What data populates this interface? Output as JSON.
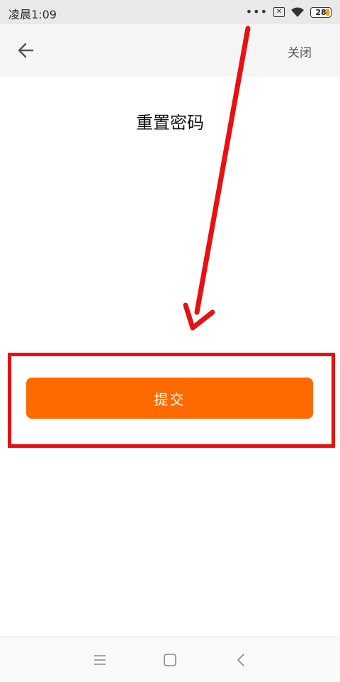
{
  "status_bar": {
    "time": "凌晨1:09",
    "battery_level": "28",
    "icons": [
      "more-dots-icon",
      "sim-error-icon",
      "wifi-icon",
      "battery-icon"
    ]
  },
  "header": {
    "back_icon": "back-arrow-icon",
    "close_label": "关闭"
  },
  "main": {
    "title": "重置密码",
    "submit_label": "提交"
  },
  "annotation": {
    "color": "#e81010",
    "shapes": [
      "arrow",
      "rectangle"
    ]
  },
  "system_nav": {
    "icons": [
      "menu-icon",
      "home-icon",
      "back-icon"
    ]
  },
  "colors": {
    "accent": "#ff6a00",
    "annotation_red": "#e81010"
  }
}
